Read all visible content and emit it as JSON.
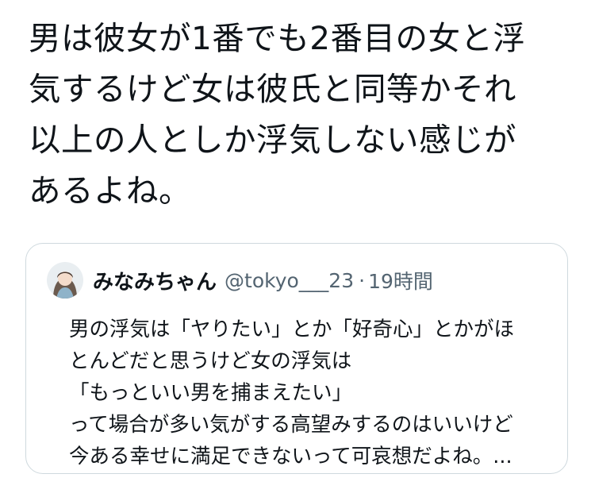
{
  "tweet": {
    "text_lines": [
      "男は彼女が1番でも2番目の女と浮",
      "気するけど女は彼氏と同等かそれ",
      "以上の人としか浮気しない感じが",
      "あるよね。"
    ]
  },
  "quote": {
    "author_name": "みなみちゃん",
    "author_handle": "@tokyo___23",
    "separator": "·",
    "time": "19時間",
    "avatar_icon": "user-avatar-icon",
    "text_lines": [
      "男の浮気は「ヤりたい」とか「好奇心」とかがほ",
      "とんどだと思うけど女の浮気は",
      "「もっといい男を捕まえたい」",
      "って場合が多い気がする高望みするのはいいけど",
      "今ある幸せに満足できないって可哀想だよね。..."
    ]
  },
  "colors": {
    "text_primary": "#0f1419",
    "text_secondary": "#536471",
    "card_border": "#cfd9de",
    "background": "#ffffff"
  }
}
